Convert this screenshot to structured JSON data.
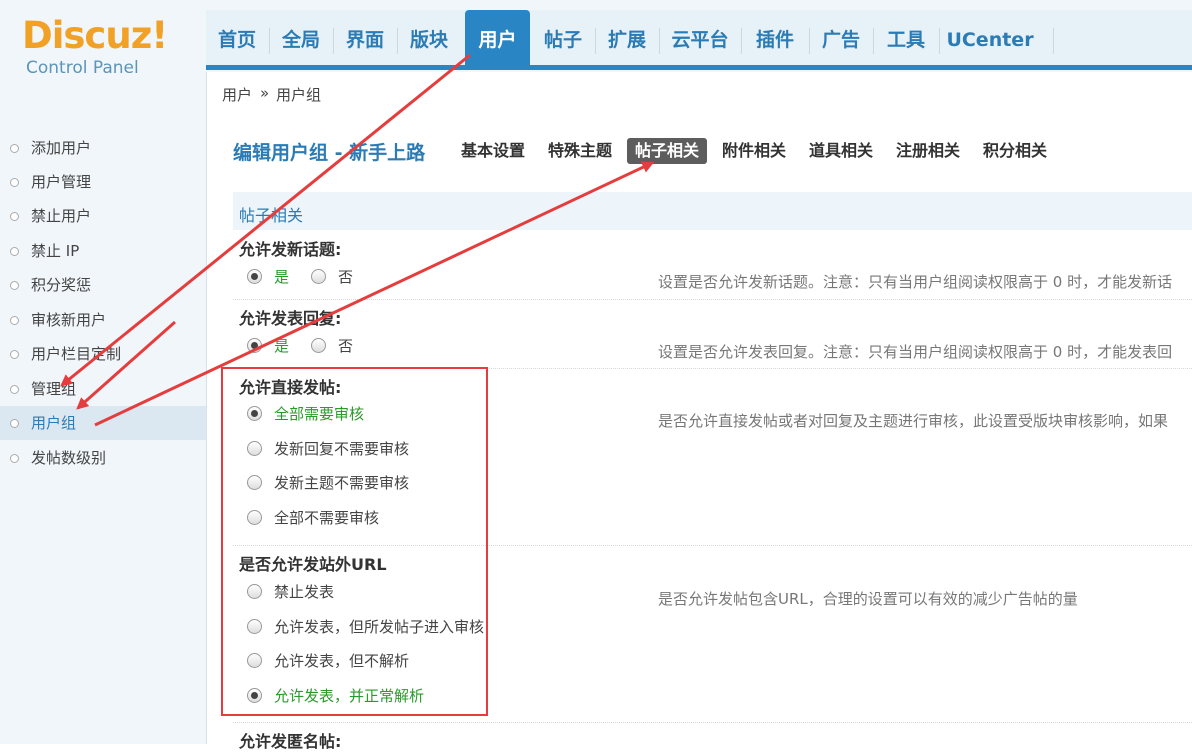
{
  "logo": {
    "brand": "Discuz",
    "bang": "!",
    "subtitle": "Control Panel"
  },
  "nav": {
    "items": [
      "首页",
      "全局",
      "界面",
      "版块",
      "用户",
      "帖子",
      "扩展",
      "云平台",
      "插件",
      "广告",
      "工具",
      "UCenter"
    ],
    "active": "用户"
  },
  "breadcrumb": {
    "root": "用户",
    "sep": "»",
    "current": "用户组"
  },
  "sidebar": {
    "items": [
      "添加用户",
      "用户管理",
      "禁止用户",
      "禁止 IP",
      "积分奖惩",
      "审核新用户",
      "用户栏目定制",
      "管理组",
      "用户组",
      "发帖数级别"
    ],
    "active": "用户组"
  },
  "page": {
    "title": "编辑用户组 - 新手上路"
  },
  "tabs": [
    "基本设置",
    "特殊主题",
    "帖子相关",
    "附件相关",
    "道具相关",
    "注册相关",
    "积分相关"
  ],
  "active_tab": "帖子相关",
  "section": {
    "heading": "帖子相关"
  },
  "settings": [
    {
      "label": "允许发新话题:",
      "options": [
        "是",
        "否"
      ],
      "selected": "是",
      "hint": "设置是否允许发新话题。注意：只有当用户组阅读权限高于 0 时，才能发新话"
    },
    {
      "label": "允许发表回复:",
      "options": [
        "是",
        "否"
      ],
      "selected": "是",
      "hint": "设置是否允许发表回复。注意：只有当用户组阅读权限高于 0 时，才能发表回"
    },
    {
      "label": "允许直接发帖:",
      "options": [
        "全部需要审核",
        "发新回复不需要审核",
        "发新主题不需要审核",
        "全部不需要审核"
      ],
      "selected": "全部需要审核",
      "hint": "是否允许直接发帖或者对回复及主题进行审核，此设置受版块审核影响，如果"
    },
    {
      "label": "是否允许发站外URL",
      "options": [
        "禁止发表",
        "允许发表，但所发帖子进入审核",
        "允许发表，但不解析",
        "允许发表，并正常解析"
      ],
      "selected": "允许发表，并正常解析",
      "hint": "是否允许发帖包含URL，合理的设置可以有效的减少广告帖的量"
    },
    {
      "label": "允许发匿名帖:"
    }
  ],
  "colors": {
    "accent": "#2a85c4",
    "annotation": "#e53d3d",
    "selected_text": "#2a9a2a"
  }
}
